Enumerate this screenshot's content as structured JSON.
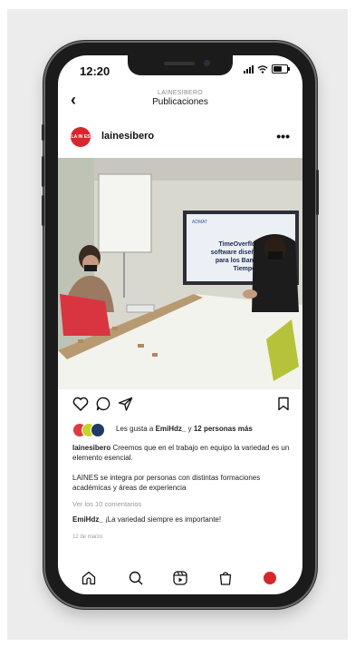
{
  "status_bar": {
    "time": "12:20"
  },
  "nav": {
    "username": "LAINESIBERO",
    "title": "Publicaciones"
  },
  "post": {
    "username": "lainesibero",
    "avatar_text": "LA IN ES",
    "screen_slide_title": "TimeOverflow: El software diseñado por y para los Bancos de Tiempo",
    "screen_slide_header": "ADMAT"
  },
  "likes": {
    "prefix": "Les gusta a ",
    "user": "EmiHdz_",
    "middle": " y ",
    "count_text": "12 personas más"
  },
  "caption1": {
    "user": "lainesibero",
    "text": " Creemos que en el trabajo en equipo la variedad es un elemento esencial."
  },
  "caption2": {
    "text": "LAINES se integra por personas con distintas formaciones académicas y áreas de experiencia"
  },
  "view_comments": "Ver los 10 comentarios",
  "comment": {
    "user": "EmiHdz_",
    "text": " ¡La variedad siempre es importante!"
  },
  "post_date": "12 de marzo",
  "colors": {
    "brand_red": "#d7262c",
    "liker_red": "#e03a3e",
    "liker_yellow": "#c8d32c",
    "liker_navy": "#1f3b66"
  },
  "icons": [
    "back-icon",
    "more-icon",
    "like-icon",
    "comment-icon",
    "share-icon",
    "save-icon",
    "home-icon",
    "search-icon",
    "reels-icon",
    "shop-icon",
    "profile-icon"
  ]
}
